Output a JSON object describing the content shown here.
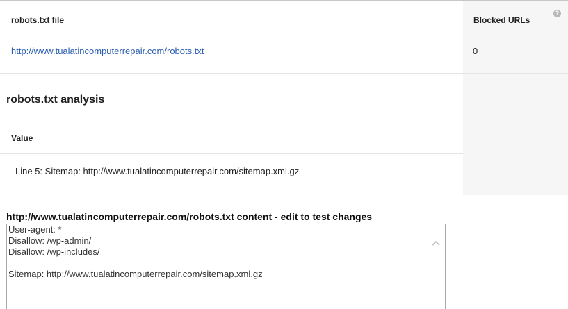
{
  "table": {
    "col_file": "robots.txt file",
    "col_blocked": "Blocked URLs",
    "help_icon": "?",
    "row": {
      "file_url": "http://www.tualatincomputerrepair.com/robots.txt",
      "blocked_count": "0"
    }
  },
  "analysis": {
    "title": "robots.txt analysis",
    "value_header": "Value",
    "line_value": "Line 5: Sitemap: http://www.tualatincomputerrepair.com/sitemap.xml.gz"
  },
  "content": {
    "title": "http://www.tualatincomputerrepair.com/robots.txt content - edit to test changes",
    "text": "User-agent: *\nDisallow: /wp-admin/\nDisallow: /wp-includes/\n\nSitemap: http://www.tualatincomputerrepair.com/sitemap.xml.gz"
  },
  "icons": {
    "help": "help-icon",
    "scroll_up": "chevron-up-icon"
  },
  "colors": {
    "link": "#2a5db0",
    "panel_bg": "#f6f6f6",
    "border": "#a9a9a9"
  }
}
